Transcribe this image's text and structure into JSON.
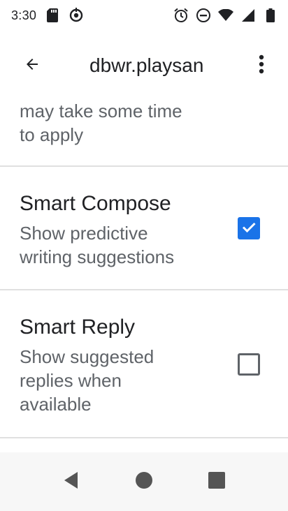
{
  "status_bar": {
    "time": "3:30",
    "icons": [
      "sd-card-icon",
      "sync-circle-icon",
      "alarm-icon",
      "do-not-disturb-icon",
      "wifi-icon",
      "signal-icon",
      "battery-icon"
    ]
  },
  "app_bar": {
    "title": "dbwr.playsan",
    "back_icon": "arrow-back-icon",
    "overflow_icon": "more-vert-icon"
  },
  "settings": {
    "partial_item": {
      "summary_line1": "may take some time",
      "summary_line2": "to apply"
    },
    "smart_compose": {
      "title": "Smart Compose",
      "summary_line1": "Show predictive",
      "summary_line2": "writing suggestions",
      "checked": true
    },
    "smart_reply": {
      "title": "Smart Reply",
      "summary_line1": "Show suggested",
      "summary_line2": "replies when",
      "summary_line3": "available",
      "checked": false
    }
  },
  "colors": {
    "accent": "#1a73e8",
    "text_primary": "#202124",
    "text_secondary": "#5f6368",
    "divider": "#e0e0e0",
    "nav_background": "#f7f7f7"
  },
  "nav_bar": {
    "icons": [
      "nav-back-icon",
      "nav-home-icon",
      "nav-recents-icon"
    ]
  }
}
